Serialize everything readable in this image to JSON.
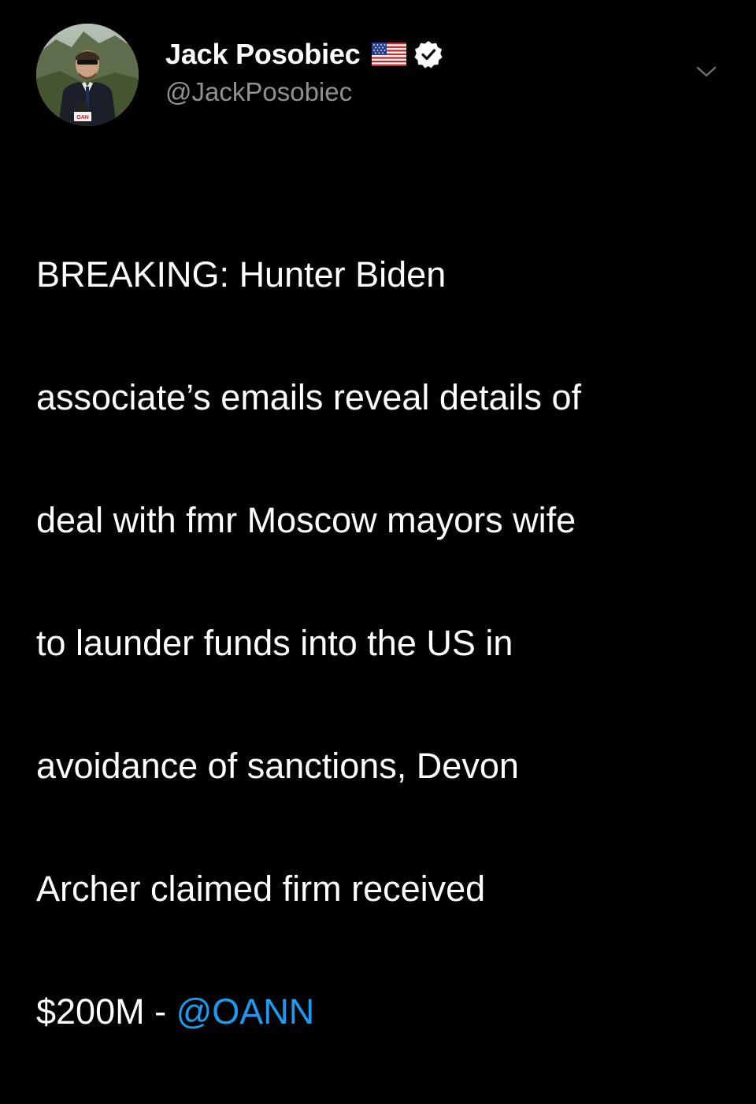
{
  "author": {
    "display_name": "Jack Posobiec",
    "handle": "@JackPosobiec",
    "flag_icon": "us-flag-icon",
    "verified_icon": "verified-badge-icon",
    "avatar_mic_text": "OAN"
  },
  "menu": {
    "icon": "chevron-down-icon"
  },
  "tweet": {
    "lines": [
      "BREAKING: Hunter Biden",
      "associate’s emails reveal details of",
      "deal with fmr Moscow mayors wife",
      "to launder funds into the US in",
      "avoidance of sanctions, Devon",
      "Archer claimed firm received"
    ],
    "last_line_prefix": "$200M - ",
    "mention": "@OANN"
  },
  "colors": {
    "background": "#000000",
    "text": "#ffffff",
    "secondary": "#8e9196",
    "link": "#1d9bf0"
  }
}
